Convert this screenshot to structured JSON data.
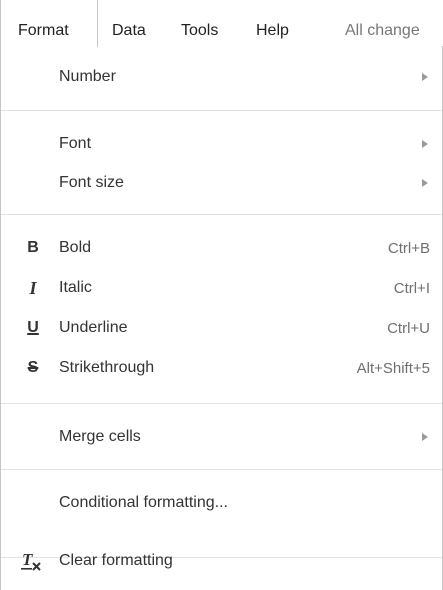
{
  "menubar": {
    "format": "Format",
    "data": "Data",
    "tools": "Tools",
    "help": "Help",
    "status": "All change"
  },
  "menu": {
    "number": "Number",
    "font": "Font",
    "font_size": "Font size",
    "bold": "Bold",
    "bold_shortcut": "Ctrl+B",
    "italic": "Italic",
    "italic_shortcut": "Ctrl+I",
    "underline": "Underline",
    "underline_shortcut": "Ctrl+U",
    "strikethrough": "Strikethrough",
    "strikethrough_shortcut": "Alt+Shift+5",
    "merge_cells": "Merge cells",
    "conditional_formatting": "Conditional formatting...",
    "clear_formatting": "Clear formatting"
  },
  "icons": {
    "bold": "bold-icon",
    "italic": "italic-icon",
    "underline": "underline-icon",
    "strikethrough": "strikethrough-icon",
    "clear_formatting": "clear-formatting-icon",
    "submenu": "submenu-arrow-icon"
  }
}
